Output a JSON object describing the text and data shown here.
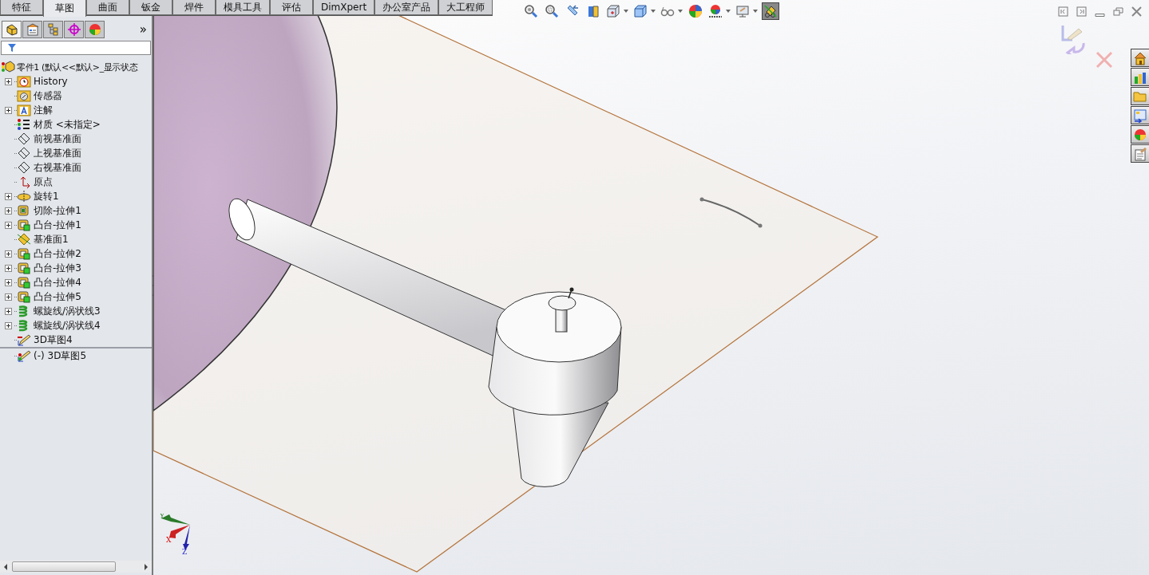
{
  "tabs": [
    {
      "label": "特征",
      "selected": false
    },
    {
      "label": "草图",
      "selected": true
    },
    {
      "label": "曲面",
      "selected": false
    },
    {
      "label": "钣金",
      "selected": false
    },
    {
      "label": "焊件",
      "selected": false
    },
    {
      "label": "模具工具",
      "selected": false
    },
    {
      "label": "评估",
      "selected": false
    },
    {
      "label": "DimXpert",
      "selected": false
    },
    {
      "label": "办公室产品",
      "selected": false
    },
    {
      "label": "大工程师",
      "selected": false
    }
  ],
  "panel_tabs": [
    {
      "kind": "feature-tree",
      "selected": true
    },
    {
      "kind": "property",
      "selected": false
    },
    {
      "kind": "config",
      "selected": false
    },
    {
      "kind": "dimxpert",
      "selected": false
    },
    {
      "kind": "display",
      "selected": false
    }
  ],
  "panel_more": "»",
  "tree": {
    "label": "零件1  (默认<<默认>_显示状态",
    "kind": "part",
    "children": [
      {
        "label": "History",
        "kind": "history",
        "expandable": true
      },
      {
        "label": "传感器",
        "kind": "sensors",
        "expandable": false
      },
      {
        "label": "注解",
        "kind": "annotations",
        "expandable": true
      },
      {
        "label": "材质 <未指定>",
        "kind": "material",
        "expandable": false
      },
      {
        "label": "前视基准面",
        "kind": "plane",
        "expandable": false
      },
      {
        "label": "上视基准面",
        "kind": "plane",
        "expandable": false
      },
      {
        "label": "右视基准面",
        "kind": "plane",
        "expandable": false
      },
      {
        "label": "原点",
        "kind": "origin",
        "expandable": false
      },
      {
        "label": "旋转1",
        "kind": "revolve",
        "expandable": true
      },
      {
        "label": "切除-拉伸1",
        "kind": "cut",
        "expandable": true
      },
      {
        "label": "凸台-拉伸1",
        "kind": "boss",
        "expandable": true
      },
      {
        "label": "基准面1",
        "kind": "ref-plane",
        "expandable": false
      },
      {
        "label": "凸台-拉伸2",
        "kind": "boss",
        "expandable": true
      },
      {
        "label": "凸台-拉伸3",
        "kind": "boss",
        "expandable": true
      },
      {
        "label": "凸台-拉伸4",
        "kind": "boss",
        "expandable": true
      },
      {
        "label": "凸台-拉伸5",
        "kind": "boss",
        "expandable": true
      },
      {
        "label": "螺旋线/涡状线3",
        "kind": "helix",
        "expandable": true
      },
      {
        "label": "螺旋线/涡状线4",
        "kind": "helix",
        "expandable": true
      },
      {
        "label": "3D草图4",
        "kind": "sketch3d",
        "expandable": false
      },
      {
        "kind": "rollback-bar"
      },
      {
        "label": "(-) 3D草图5",
        "kind": "sketch3d-error",
        "expandable": false
      }
    ]
  },
  "view_toolbar": [
    {
      "kind": "zoom-fit",
      "dropdown": false,
      "selected": false
    },
    {
      "kind": "zoom-area",
      "dropdown": false,
      "selected": false
    },
    {
      "kind": "previous-view",
      "dropdown": false,
      "selected": false
    },
    {
      "kind": "section-view",
      "dropdown": false,
      "selected": false
    },
    {
      "kind": "view-orientation",
      "dropdown": true,
      "selected": false
    },
    {
      "kind": "display-style",
      "dropdown": true,
      "selected": false
    },
    {
      "kind": "hide-show",
      "dropdown": true,
      "selected": false
    },
    {
      "kind": "appearance",
      "dropdown": false,
      "selected": false
    },
    {
      "kind": "scene",
      "dropdown": true,
      "selected": false
    },
    {
      "kind": "view-settings",
      "dropdown": true,
      "selected": false
    },
    {
      "kind": "realview",
      "dropdown": false,
      "selected": true
    }
  ],
  "window_controls": [
    {
      "kind": "tile-left"
    },
    {
      "kind": "tile-right"
    },
    {
      "kind": "minimize"
    },
    {
      "kind": "restore"
    },
    {
      "kind": "close"
    }
  ],
  "task_pane": [
    {
      "kind": "home"
    },
    {
      "kind": "library"
    },
    {
      "kind": "folder"
    },
    {
      "kind": "palette"
    },
    {
      "kind": "appearances"
    },
    {
      "kind": "properties"
    }
  ],
  "triad": {
    "x": "X",
    "y": "Y",
    "z": "Z"
  }
}
